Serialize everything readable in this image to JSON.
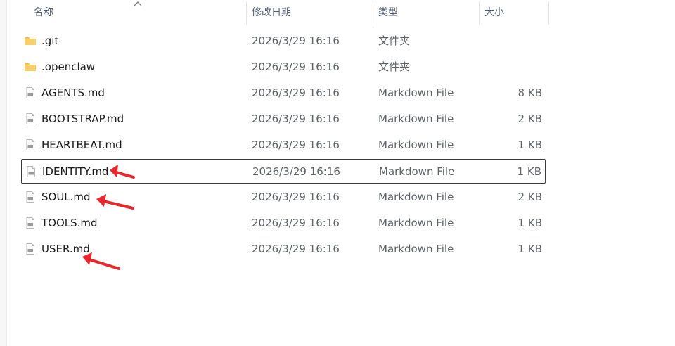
{
  "columns": {
    "name": "名称",
    "date": "修改日期",
    "type": "类型",
    "size": "大小"
  },
  "files": [
    {
      "name": ".git",
      "date": "2026/3/29 16:16",
      "type": "文件夹",
      "size": "",
      "icon": "folder-icon"
    },
    {
      "name": ".openclaw",
      "date": "2026/3/29 16:16",
      "type": "文件夹",
      "size": "",
      "icon": "folder-icon"
    },
    {
      "name": "AGENTS.md",
      "date": "2026/3/29 16:16",
      "type": "Markdown File",
      "size": "8 KB",
      "icon": "markdown-file-icon"
    },
    {
      "name": "BOOTSTRAP.md",
      "date": "2026/3/29 16:16",
      "type": "Markdown File",
      "size": "2 KB",
      "icon": "markdown-file-icon"
    },
    {
      "name": "HEARTBEAT.md",
      "date": "2026/3/29 16:16",
      "type": "Markdown File",
      "size": "1 KB",
      "icon": "markdown-file-icon"
    },
    {
      "name": "IDENTITY.md",
      "date": "2026/3/29 16:16",
      "type": "Markdown File",
      "size": "1 KB",
      "icon": "markdown-file-icon",
      "selected": true
    },
    {
      "name": "SOUL.md",
      "date": "2026/3/29 16:16",
      "type": "Markdown File",
      "size": "2 KB",
      "icon": "markdown-file-icon"
    },
    {
      "name": "TOOLS.md",
      "date": "2026/3/29 16:16",
      "type": "Markdown File",
      "size": "1 KB",
      "icon": "markdown-file-icon"
    },
    {
      "name": "USER.md",
      "date": "2026/3/29 16:16",
      "type": "Markdown File",
      "size": "1 KB",
      "icon": "markdown-file-icon"
    }
  ],
  "sort_indicator": "chevron-up-icon",
  "annotation_color": "#e8262b",
  "folder_color": "#f5c24c"
}
